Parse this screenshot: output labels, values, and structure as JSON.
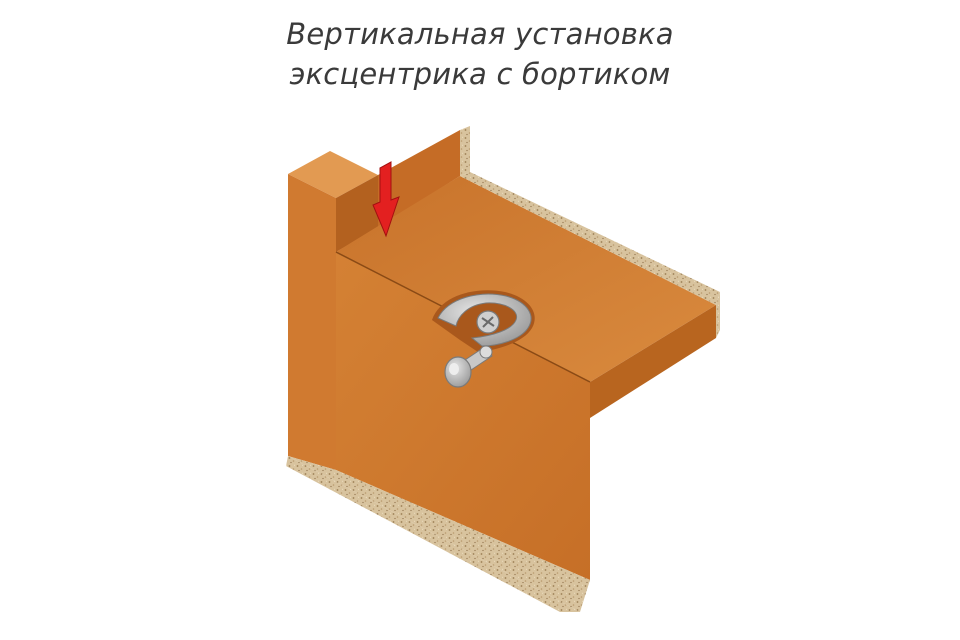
{
  "title": {
    "line1": "Вертикальная установка",
    "line2": "эксцентрика с бортиком"
  },
  "colors": {
    "wood_light": "#d9853a",
    "wood_mid": "#c8702a",
    "wood_dark": "#a85a1e",
    "chipboard": "#d9c29b",
    "arrow": "#e02020",
    "metal": "#b9b9b9"
  },
  "icons": [
    "down-arrow-icon",
    "eccentric-fitting-icon"
  ]
}
